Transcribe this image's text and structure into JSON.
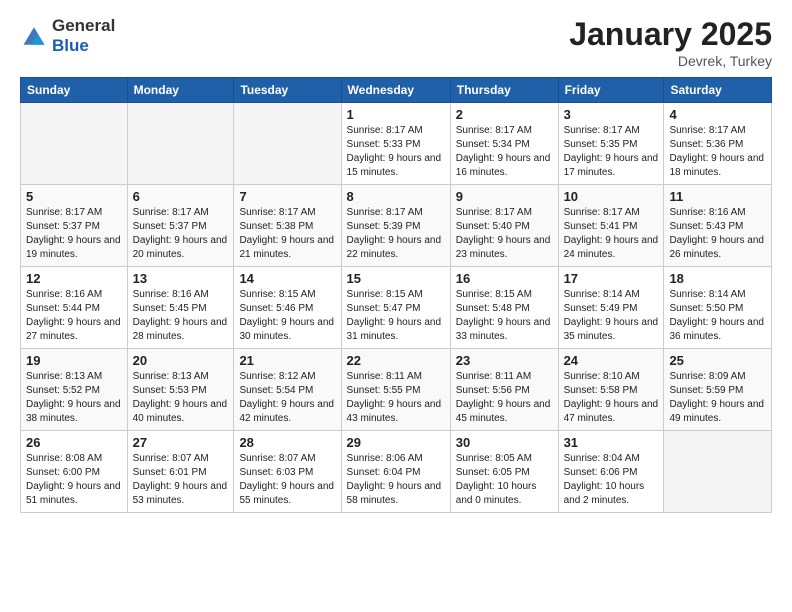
{
  "header": {
    "logo_general": "General",
    "logo_blue": "Blue",
    "title": "January 2025",
    "location": "Devrek, Turkey"
  },
  "weekdays": [
    "Sunday",
    "Monday",
    "Tuesday",
    "Wednesday",
    "Thursday",
    "Friday",
    "Saturday"
  ],
  "weeks": [
    [
      {
        "day": "",
        "sunrise": "",
        "sunset": "",
        "daylight": ""
      },
      {
        "day": "",
        "sunrise": "",
        "sunset": "",
        "daylight": ""
      },
      {
        "day": "",
        "sunrise": "",
        "sunset": "",
        "daylight": ""
      },
      {
        "day": "1",
        "sunrise": "Sunrise: 8:17 AM",
        "sunset": "Sunset: 5:33 PM",
        "daylight": "Daylight: 9 hours and 15 minutes."
      },
      {
        "day": "2",
        "sunrise": "Sunrise: 8:17 AM",
        "sunset": "Sunset: 5:34 PM",
        "daylight": "Daylight: 9 hours and 16 minutes."
      },
      {
        "day": "3",
        "sunrise": "Sunrise: 8:17 AM",
        "sunset": "Sunset: 5:35 PM",
        "daylight": "Daylight: 9 hours and 17 minutes."
      },
      {
        "day": "4",
        "sunrise": "Sunrise: 8:17 AM",
        "sunset": "Sunset: 5:36 PM",
        "daylight": "Daylight: 9 hours and 18 minutes."
      }
    ],
    [
      {
        "day": "5",
        "sunrise": "Sunrise: 8:17 AM",
        "sunset": "Sunset: 5:37 PM",
        "daylight": "Daylight: 9 hours and 19 minutes."
      },
      {
        "day": "6",
        "sunrise": "Sunrise: 8:17 AM",
        "sunset": "Sunset: 5:37 PM",
        "daylight": "Daylight: 9 hours and 20 minutes."
      },
      {
        "day": "7",
        "sunrise": "Sunrise: 8:17 AM",
        "sunset": "Sunset: 5:38 PM",
        "daylight": "Daylight: 9 hours and 21 minutes."
      },
      {
        "day": "8",
        "sunrise": "Sunrise: 8:17 AM",
        "sunset": "Sunset: 5:39 PM",
        "daylight": "Daylight: 9 hours and 22 minutes."
      },
      {
        "day": "9",
        "sunrise": "Sunrise: 8:17 AM",
        "sunset": "Sunset: 5:40 PM",
        "daylight": "Daylight: 9 hours and 23 minutes."
      },
      {
        "day": "10",
        "sunrise": "Sunrise: 8:17 AM",
        "sunset": "Sunset: 5:41 PM",
        "daylight": "Daylight: 9 hours and 24 minutes."
      },
      {
        "day": "11",
        "sunrise": "Sunrise: 8:16 AM",
        "sunset": "Sunset: 5:43 PM",
        "daylight": "Daylight: 9 hours and 26 minutes."
      }
    ],
    [
      {
        "day": "12",
        "sunrise": "Sunrise: 8:16 AM",
        "sunset": "Sunset: 5:44 PM",
        "daylight": "Daylight: 9 hours and 27 minutes."
      },
      {
        "day": "13",
        "sunrise": "Sunrise: 8:16 AM",
        "sunset": "Sunset: 5:45 PM",
        "daylight": "Daylight: 9 hours and 28 minutes."
      },
      {
        "day": "14",
        "sunrise": "Sunrise: 8:15 AM",
        "sunset": "Sunset: 5:46 PM",
        "daylight": "Daylight: 9 hours and 30 minutes."
      },
      {
        "day": "15",
        "sunrise": "Sunrise: 8:15 AM",
        "sunset": "Sunset: 5:47 PM",
        "daylight": "Daylight: 9 hours and 31 minutes."
      },
      {
        "day": "16",
        "sunrise": "Sunrise: 8:15 AM",
        "sunset": "Sunset: 5:48 PM",
        "daylight": "Daylight: 9 hours and 33 minutes."
      },
      {
        "day": "17",
        "sunrise": "Sunrise: 8:14 AM",
        "sunset": "Sunset: 5:49 PM",
        "daylight": "Daylight: 9 hours and 35 minutes."
      },
      {
        "day": "18",
        "sunrise": "Sunrise: 8:14 AM",
        "sunset": "Sunset: 5:50 PM",
        "daylight": "Daylight: 9 hours and 36 minutes."
      }
    ],
    [
      {
        "day": "19",
        "sunrise": "Sunrise: 8:13 AM",
        "sunset": "Sunset: 5:52 PM",
        "daylight": "Daylight: 9 hours and 38 minutes."
      },
      {
        "day": "20",
        "sunrise": "Sunrise: 8:13 AM",
        "sunset": "Sunset: 5:53 PM",
        "daylight": "Daylight: 9 hours and 40 minutes."
      },
      {
        "day": "21",
        "sunrise": "Sunrise: 8:12 AM",
        "sunset": "Sunset: 5:54 PM",
        "daylight": "Daylight: 9 hours and 42 minutes."
      },
      {
        "day": "22",
        "sunrise": "Sunrise: 8:11 AM",
        "sunset": "Sunset: 5:55 PM",
        "daylight": "Daylight: 9 hours and 43 minutes."
      },
      {
        "day": "23",
        "sunrise": "Sunrise: 8:11 AM",
        "sunset": "Sunset: 5:56 PM",
        "daylight": "Daylight: 9 hours and 45 minutes."
      },
      {
        "day": "24",
        "sunrise": "Sunrise: 8:10 AM",
        "sunset": "Sunset: 5:58 PM",
        "daylight": "Daylight: 9 hours and 47 minutes."
      },
      {
        "day": "25",
        "sunrise": "Sunrise: 8:09 AM",
        "sunset": "Sunset: 5:59 PM",
        "daylight": "Daylight: 9 hours and 49 minutes."
      }
    ],
    [
      {
        "day": "26",
        "sunrise": "Sunrise: 8:08 AM",
        "sunset": "Sunset: 6:00 PM",
        "daylight": "Daylight: 9 hours and 51 minutes."
      },
      {
        "day": "27",
        "sunrise": "Sunrise: 8:07 AM",
        "sunset": "Sunset: 6:01 PM",
        "daylight": "Daylight: 9 hours and 53 minutes."
      },
      {
        "day": "28",
        "sunrise": "Sunrise: 8:07 AM",
        "sunset": "Sunset: 6:03 PM",
        "daylight": "Daylight: 9 hours and 55 minutes."
      },
      {
        "day": "29",
        "sunrise": "Sunrise: 8:06 AM",
        "sunset": "Sunset: 6:04 PM",
        "daylight": "Daylight: 9 hours and 58 minutes."
      },
      {
        "day": "30",
        "sunrise": "Sunrise: 8:05 AM",
        "sunset": "Sunset: 6:05 PM",
        "daylight": "Daylight: 10 hours and 0 minutes."
      },
      {
        "day": "31",
        "sunrise": "Sunrise: 8:04 AM",
        "sunset": "Sunset: 6:06 PM",
        "daylight": "Daylight: 10 hours and 2 minutes."
      },
      {
        "day": "",
        "sunrise": "",
        "sunset": "",
        "daylight": ""
      }
    ]
  ]
}
